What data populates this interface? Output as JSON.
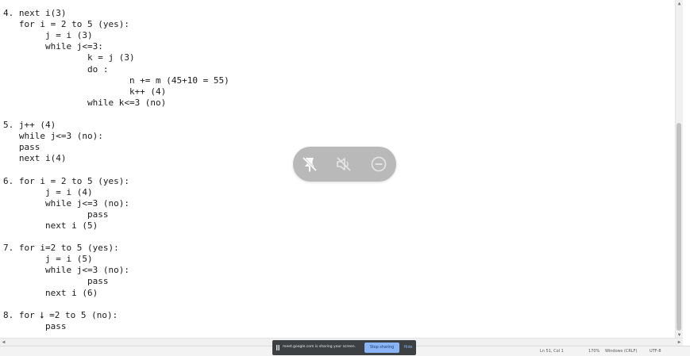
{
  "editor": {
    "lines": [
      "4. next i(3)",
      "   for i = 2 to 5 (yes):",
      "        j = i (3)",
      "        while j<=3:",
      "                k = j (3)",
      "                do :",
      "                        n += m (45+10 = 55)",
      "                        k++ (4)",
      "                while k<=3 (no)",
      "",
      "5. j++ (4)",
      "   while j<=3 (no):",
      "   pass",
      "   next i(4)",
      "",
      "6. for i = 2 to 5 (yes):",
      "        j = i (4)",
      "        while j<=3 (no):",
      "                pass",
      "        next i (5)",
      "",
      "7. for i=2 to 5 (yes):",
      "        j = i (5)",
      "        while j<=3 (no):",
      "                pass",
      "        next i (6)",
      "",
      "8. for ⭣ =2 to 5 (no):",
      "        pass"
    ]
  },
  "status_bar": {
    "position": "Ln 51, Col 1",
    "zoom": "170%",
    "line_ending": "Windows (CRLF)",
    "encoding": "UTF-8"
  },
  "meet_controls": {
    "icons": [
      "unpin-icon",
      "mute-icon",
      "remove-icon"
    ]
  },
  "share_banner": {
    "message": "meet.google.com is sharing your screen.",
    "stop_label": "Stop sharing",
    "hide_label": "Hide"
  }
}
